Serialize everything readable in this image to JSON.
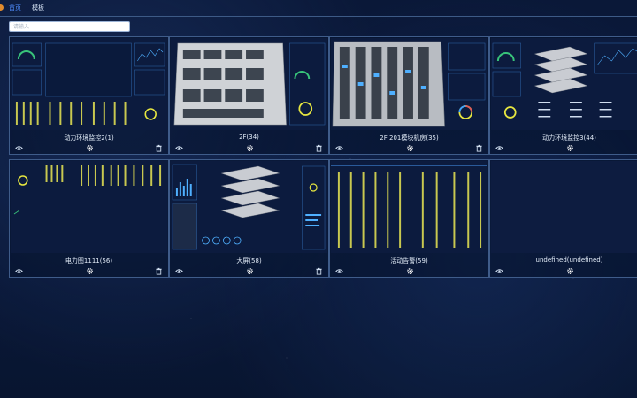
{
  "nav": {
    "tabs": [
      {
        "label": "首页",
        "active": true
      },
      {
        "label": "模板",
        "active": false
      }
    ]
  },
  "search": {
    "placeholder": "请输入"
  },
  "cards": [
    {
      "title": "动力环境监控2(1)",
      "has_delete": true
    },
    {
      "title": "2F(34)",
      "has_delete": true
    },
    {
      "title": "2F 201模块机房(35)",
      "has_delete": true
    },
    {
      "title": "动力环境监控3(44)",
      "has_delete": false
    },
    {
      "title": "电力图1111(56)",
      "has_delete": true
    },
    {
      "title": "大屏(58)",
      "has_delete": true
    },
    {
      "title": "活动告警(59)",
      "has_delete": false
    },
    {
      "title": "undefined(undefined)",
      "has_delete": false
    }
  ],
  "colors": {
    "accent": "#4f8cff",
    "card_border": "#3f5c8a",
    "background": "#0b1a3d",
    "chart_yellow": "#e6e640"
  }
}
